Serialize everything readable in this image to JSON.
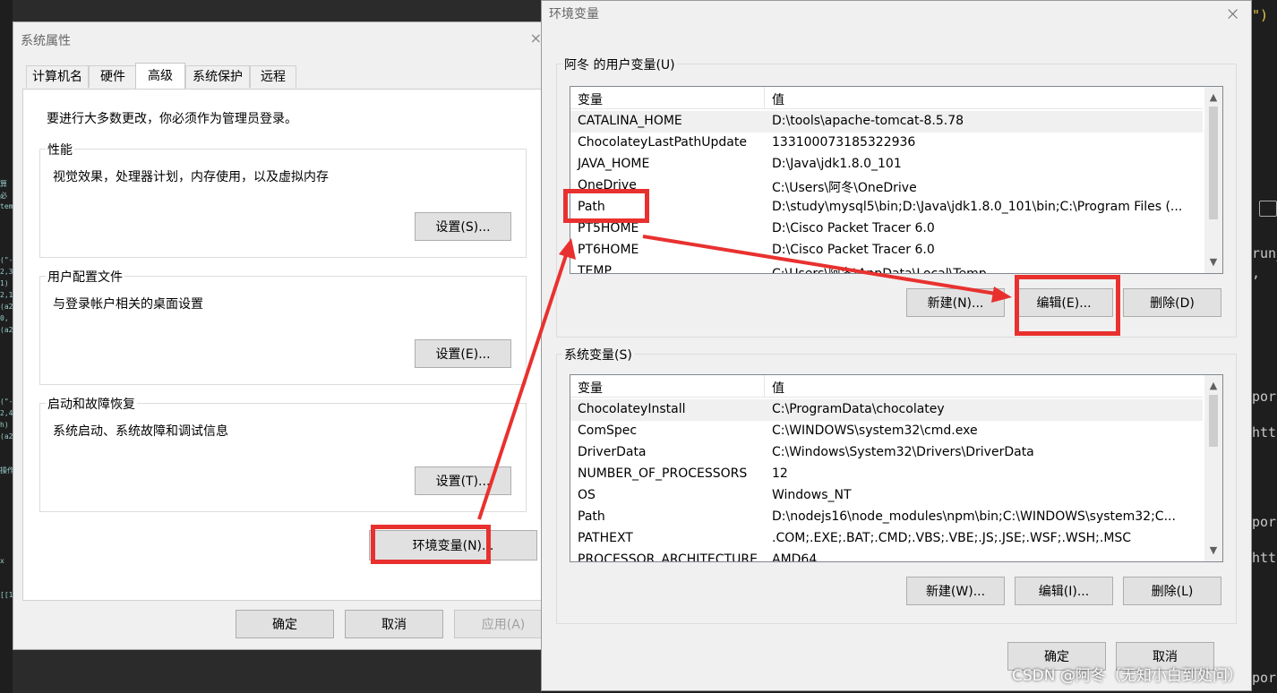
{
  "background_code": {
    "left_lines": [
      "算",
      "必",
      "tem",
      "(\"-",
      "2,3",
      "1)",
      "2,1",
      "(a2",
      "0,",
      "(a2",
      "(\"-",
      "2,4",
      "h)",
      "(a2",
      "操作",
      "x",
      "[[1"
    ],
    "right_lines": {
      "top": "\")",
      "run": "run_",
      "comma": ",",
      "pora1": "pora",
      "http1": "http",
      "pora2": "pora",
      "http2": "http",
      "pora3": "pora"
    }
  },
  "system_properties": {
    "title": "系统属性",
    "close": "×",
    "tabs": [
      "计算机名",
      "硬件",
      "高级",
      "系统保护",
      "远程"
    ],
    "active_tab": "高级",
    "admin_note": "要进行大多数更改，你必须作为管理员登录。",
    "performance": {
      "title": "性能",
      "desc": "视觉效果，处理器计划，内存使用，以及虚拟内存",
      "button": "设置(S)..."
    },
    "user_profiles": {
      "title": "用户配置文件",
      "desc": "与登录帐户相关的桌面设置",
      "button": "设置(E)..."
    },
    "startup_recovery": {
      "title": "启动和故障恢复",
      "desc": "系统启动、系统故障和调试信息",
      "button": "设置(T)..."
    },
    "env_button": "环境变量(N)...",
    "ok": "确定",
    "cancel": "取消",
    "apply": "应用(A)"
  },
  "env_vars": {
    "title": "环境变量",
    "close": "×",
    "user_section": {
      "title": "阿冬 的用户变量(U)",
      "col_var": "变量",
      "col_val": "值",
      "rows": [
        {
          "name": "CATALINA_HOME",
          "value": "D:\\tools\\apache-tomcat-8.5.78"
        },
        {
          "name": "ChocolateyLastPathUpdate",
          "value": "133100073185322936"
        },
        {
          "name": "JAVA_HOME",
          "value": "D:\\Java\\jdk1.8.0_101"
        },
        {
          "name": "OneDrive",
          "value": "C:\\Users\\阿冬\\OneDrive"
        },
        {
          "name": "Path",
          "value": "D:\\study\\mysql5\\bin;D:\\Java\\jdk1.8.0_101\\bin;C:\\Program Files (..."
        },
        {
          "name": "PT5HOME",
          "value": "D:\\Cisco Packet Tracer 6.0"
        },
        {
          "name": "PT6HOME",
          "value": "D:\\Cisco Packet Tracer 6.0"
        },
        {
          "name": "TEMP",
          "value": "C:\\Users\\阿冬\\AppData\\Local\\Temp"
        }
      ],
      "new": "新建(N)...",
      "edit": "编辑(E)...",
      "delete": "删除(D)"
    },
    "system_section": {
      "title": "系统变量(S)",
      "col_var": "变量",
      "col_val": "值",
      "rows": [
        {
          "name": "ChocolateyInstall",
          "value": "C:\\ProgramData\\chocolatey"
        },
        {
          "name": "ComSpec",
          "value": "C:\\WINDOWS\\system32\\cmd.exe"
        },
        {
          "name": "DriverData",
          "value": "C:\\Windows\\System32\\Drivers\\DriverData"
        },
        {
          "name": "NUMBER_OF_PROCESSORS",
          "value": "12"
        },
        {
          "name": "OS",
          "value": "Windows_NT"
        },
        {
          "name": "Path",
          "value": "D:\\nodejs16\\node_modules\\npm\\bin;C:\\WINDOWS\\system32;C..."
        },
        {
          "name": "PATHEXT",
          "value": ".COM;.EXE;.BAT;.CMD;.VBS;.VBE;.JS;.JSE;.WSF;.WSH;.MSC"
        },
        {
          "name": "PROCESSOR_ARCHITECTURE",
          "value": "AMD64"
        }
      ],
      "new": "新建(W)...",
      "edit": "编辑(I)...",
      "delete": "删除(L)"
    },
    "ok": "确定",
    "cancel": "取消"
  },
  "watermark": "CSDN @阿冬（无知小白到处问）",
  "annotation_color": "#e8312f"
}
